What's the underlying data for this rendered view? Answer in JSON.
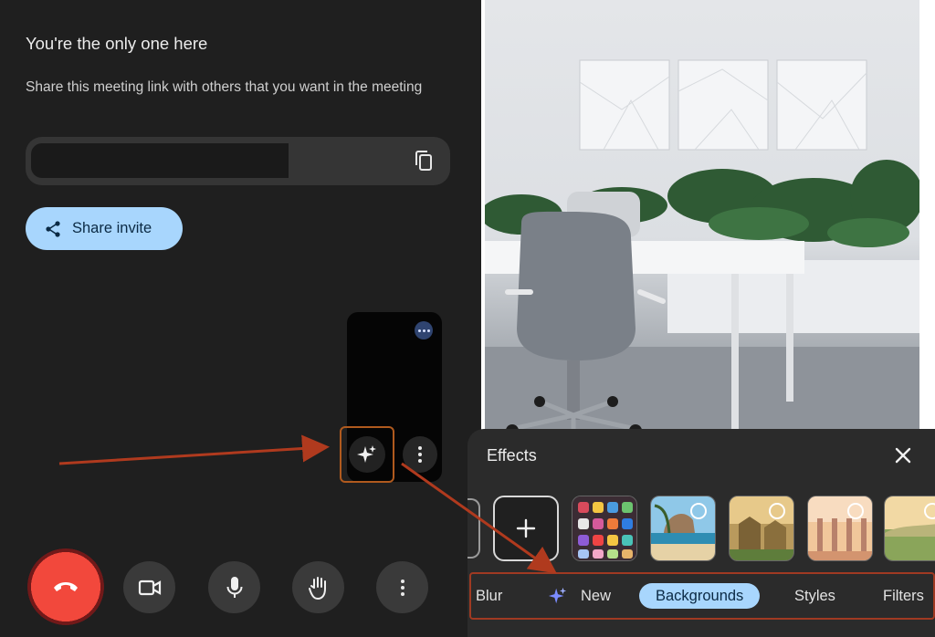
{
  "meeting": {
    "title": "You're the only one here",
    "description": "Share this meeting link with others that you want in the meeting",
    "share_button_label": "Share invite"
  },
  "effects": {
    "title": "Effects",
    "tabs": [
      {
        "label": "Blur",
        "selected": false
      },
      {
        "label": "New",
        "selected": false
      },
      {
        "label": "Backgrounds",
        "selected": true
      },
      {
        "label": "Styles",
        "selected": false
      },
      {
        "label": "Filters",
        "selected": false
      }
    ]
  },
  "icons": {
    "copy": "copy-icon",
    "share": "share-icon",
    "effects": "sparkle-icon",
    "more": "more-vertical-icon",
    "end_call": "end-call-icon",
    "camera": "video-camera-icon",
    "mic": "microphone-icon",
    "hand": "raise-hand-icon",
    "close": "close-icon",
    "add": "plus-icon"
  },
  "colors": {
    "accent": "#a8d6fd",
    "end_call": "#f2483c",
    "annotation": "#b03a1e",
    "background": "#1f1f1f",
    "panel": "#2b2b2b"
  }
}
